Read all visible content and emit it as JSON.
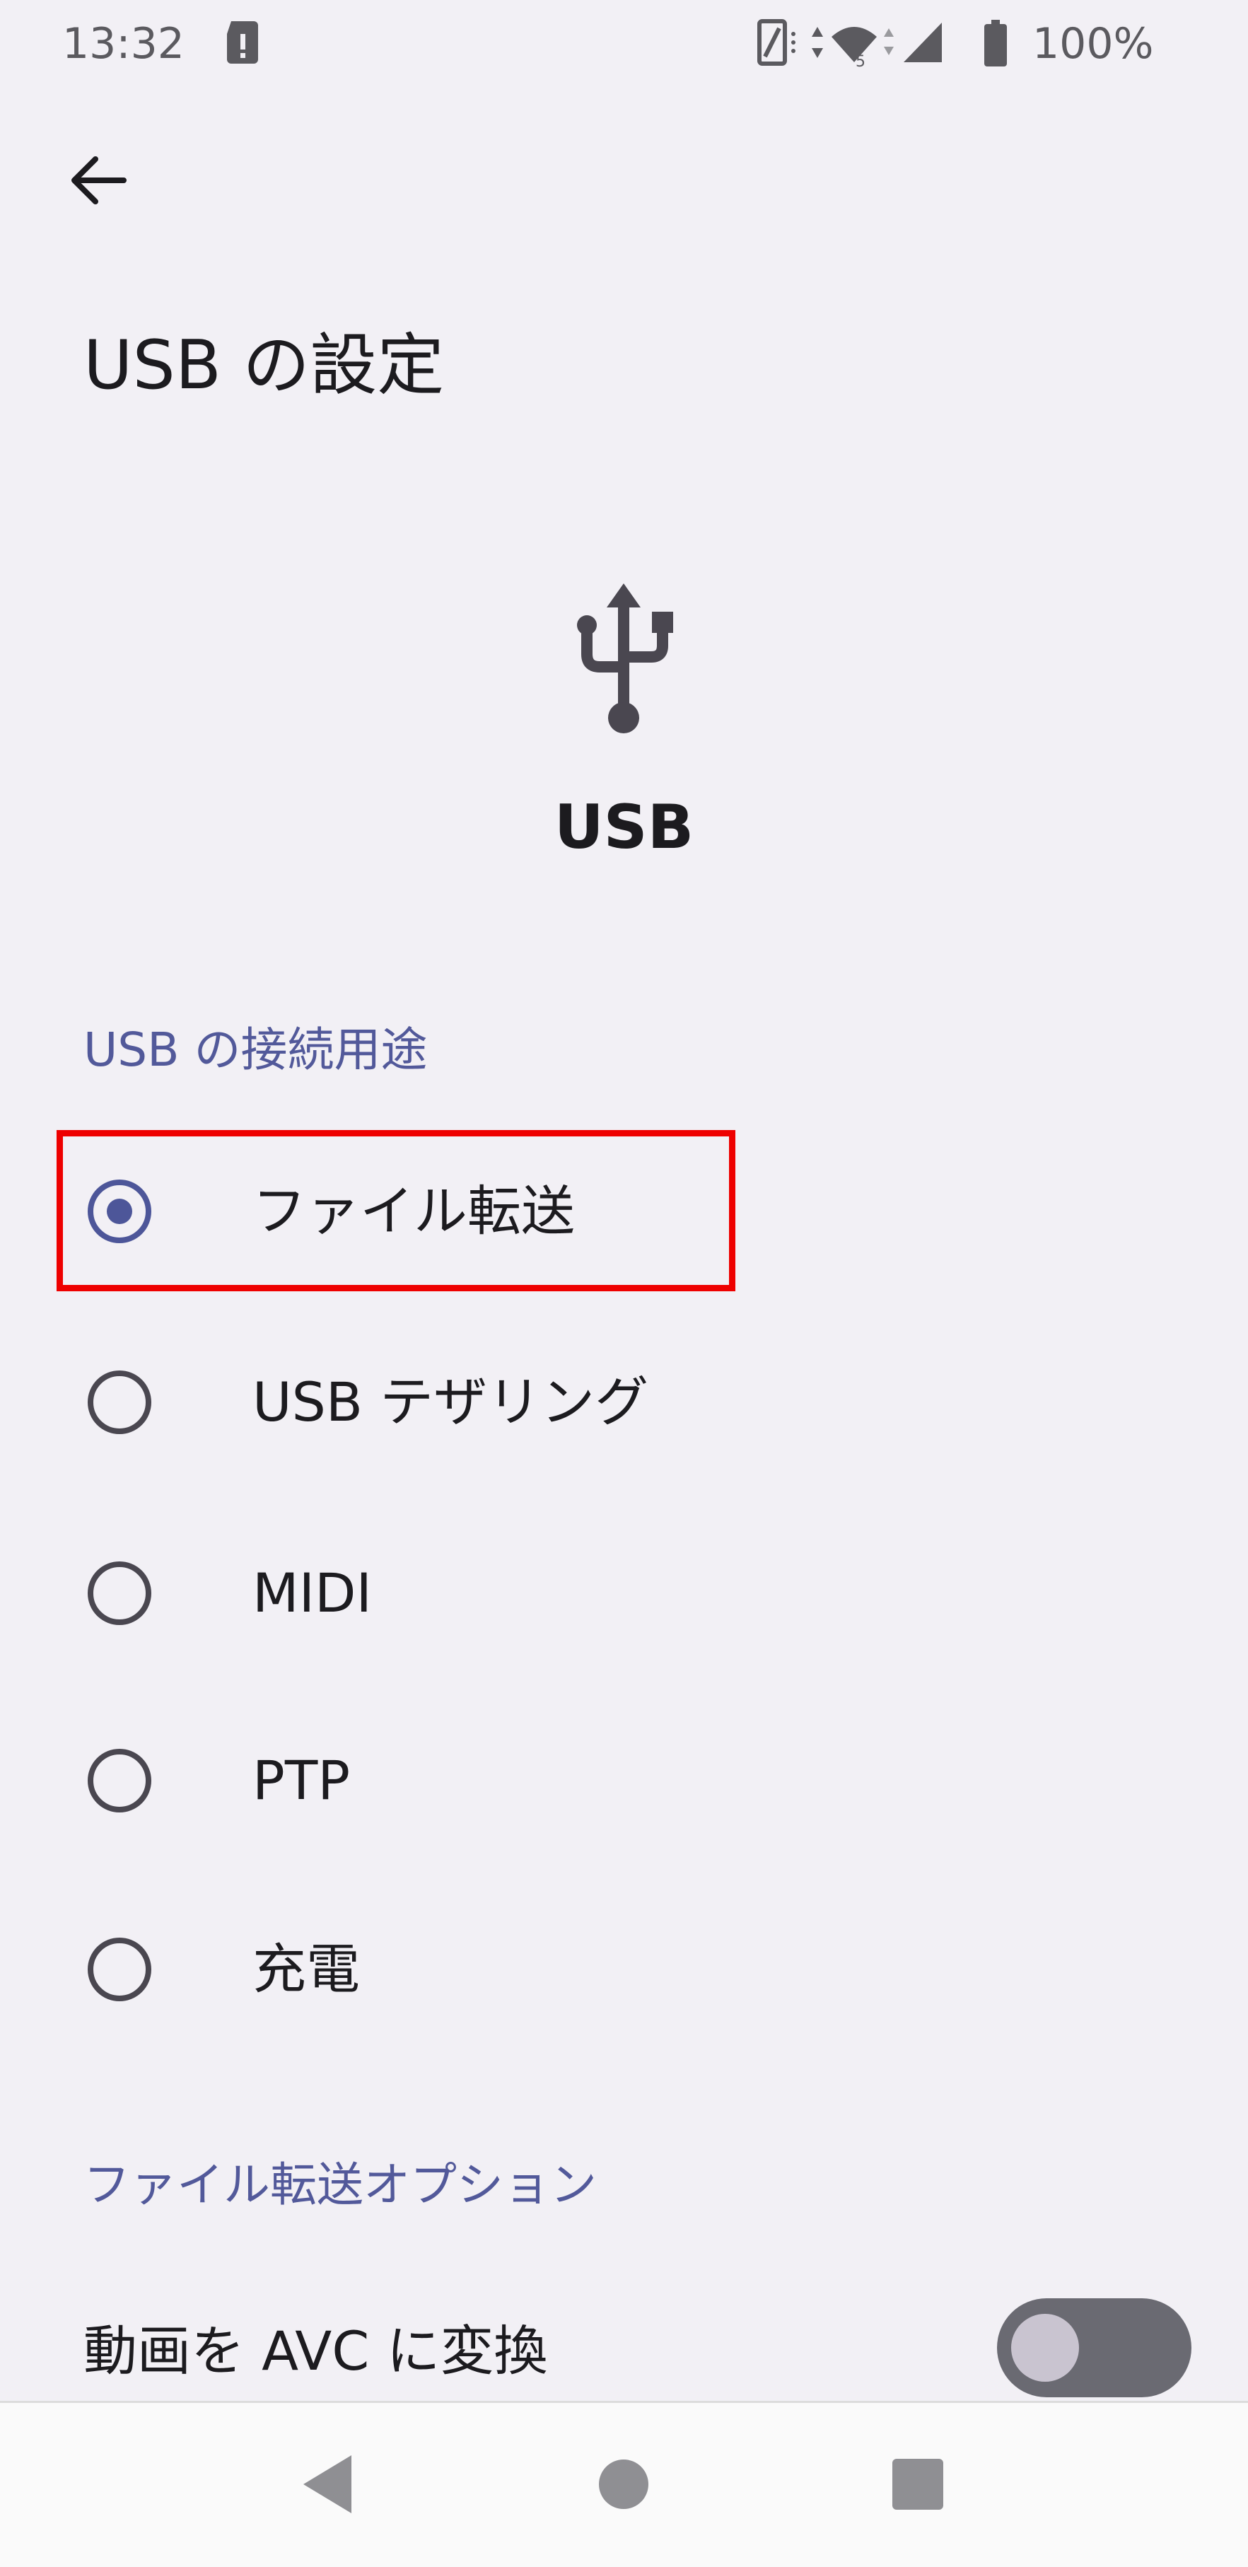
{
  "status_bar": {
    "time": "13:32",
    "battery_text": "100%",
    "icons": [
      "sd-card-alert-icon",
      "nfc-icon",
      "data-arrows-icon",
      "wifi-icon",
      "signal-icon",
      "battery-icon"
    ]
  },
  "header": {
    "back_icon": "arrow-back-icon",
    "title": "USB の設定"
  },
  "hero": {
    "icon": "usb-icon",
    "label": "USB"
  },
  "usb_purpose": {
    "header": "USB の接続用途",
    "selected_index": 0,
    "options": [
      {
        "label": "ファイル転送",
        "checked": true
      },
      {
        "label": "USB テザリング",
        "checked": false
      },
      {
        "label": "MIDI",
        "checked": false
      },
      {
        "label": "PTP",
        "checked": false
      },
      {
        "label": "充電",
        "checked": false
      }
    ]
  },
  "file_transfer_options": {
    "header": "ファイル転送オプション",
    "avc_label": "動画を AVC に変換",
    "avc_enabled": false
  },
  "navigation": {
    "back_icon": "nav-back-triangle-icon",
    "home_icon": "nav-home-circle-icon",
    "recents_icon": "nav-recents-square-icon"
  },
  "colors": {
    "background": "#f2f0f5",
    "accent": "#4d5699",
    "section_header": "#52599a",
    "highlight": "#ee0000"
  }
}
